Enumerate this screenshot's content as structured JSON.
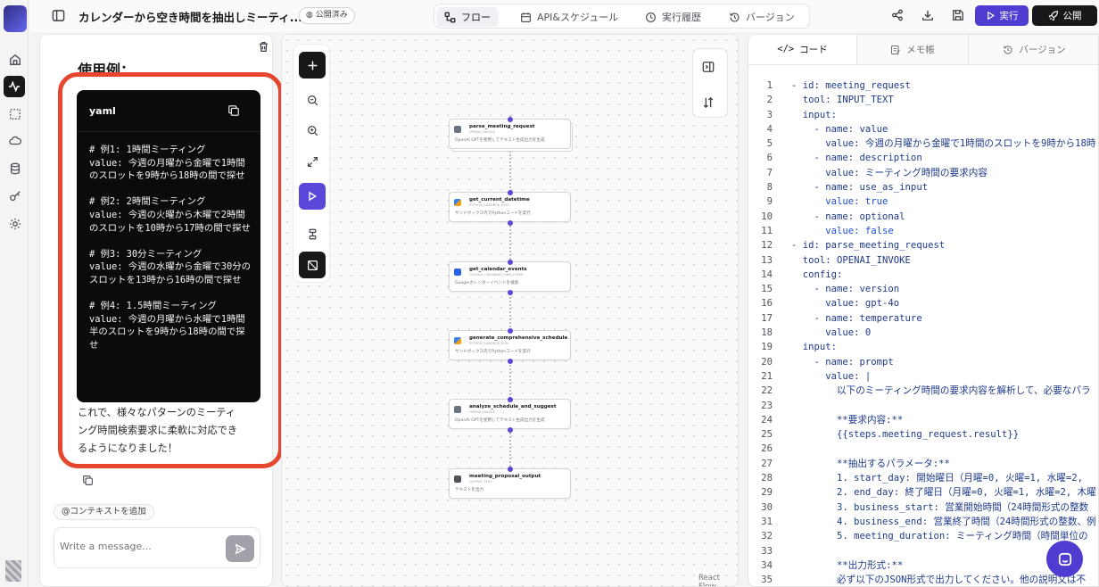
{
  "topbar": {
    "title": "カレンダーから空き時間を抽出しミーティ...",
    "badge": "公開済み",
    "tabs": [
      {
        "label": "フロー",
        "icon": "flow-icon",
        "selected": true
      },
      {
        "label": "API&スケジュール",
        "icon": "calendar-icon"
      },
      {
        "label": "実行履歴",
        "icon": "clock-icon"
      },
      {
        "label": "バージョン",
        "icon": "history-icon"
      }
    ],
    "run_label": "実行",
    "publish_label": "公開"
  },
  "chat": {
    "heading": "使用例：",
    "code_lang": "yaml",
    "code_blocks": [
      "# 例1: 1時間ミーティング\nvalue: 今週の月曜から金曜で1時間のスロットを9時から18時の間で探せ",
      "# 例2: 2時間ミーティング\nvalue: 今週の火曜から木曜で2時間のスロットを10時から17時の間で探せ",
      "# 例3: 30分ミーティング\nvalue: 今週の水曜から金曜で30分のスロットを13時から16時の間で探せ",
      "# 例4: 1.5時間ミーティング\nvalue: 今週の月曜から水曜で1時間半のスロットを9時から18時の間で探せ"
    ],
    "after_text": "これで、様々なパターンのミーティング時間検索要求に柔軟に対応できるようになりました！",
    "context_chip": "@コンテキストを追加",
    "input_placeholder": "Write a message..."
  },
  "flow": {
    "nodes": [
      {
        "name": "parse_meeting_request",
        "tool": "OPENAI_INVOKE",
        "desc": "OpenAI GPTを使用してテキスト生成出力を生成",
        "color": "#6b7280"
      },
      {
        "name": "get_current_datetime",
        "tool": "PYTHON_SANDBOX_RUN",
        "desc": "サンドボックス内でPythonコードを実行",
        "color": "#f59e0b"
      },
      {
        "name": "get_calendar_events",
        "tool": "GOOGLE_CALENDAR_FIND_EVENT",
        "desc": "Googleカレンダーイベントを検索",
        "color": "#2563eb"
      },
      {
        "name": "generate_comprehensive_schedule",
        "tool": "PYTHON_SANDBOX_RUN",
        "desc": "サンドボックス内でPythonコードを実行",
        "color": "#f59e0b"
      },
      {
        "name": "analyze_schedule_and_suggest",
        "tool": "OPENAI_INVOKE",
        "desc": "OpenAI GPTを使用してテキスト生成出力を生成",
        "color": "#6b7280"
      },
      {
        "name": "meeting_proposal_output",
        "tool": "OUTPUT_TEXT",
        "desc": "テキストを出力",
        "color": "#52525b"
      }
    ],
    "attribution": "React Flow"
  },
  "code_panel": {
    "tabs": [
      {
        "label": "コード",
        "icon": "code-icon",
        "selected": true
      },
      {
        "label": "メモ帳",
        "icon": "notepad-icon"
      },
      {
        "label": "バージョン",
        "icon": "history-icon"
      }
    ],
    "lines": [
      "- id: meeting_request",
      "  tool: INPUT_TEXT",
      "  input:",
      "    - name: value",
      "      value: 今週の月曜から金曜で1時間のスロットを9時から18時",
      "    - name: description",
      "      value: ミーティング時間の要求内容",
      "    - name: use_as_input",
      "      value: true",
      "    - name: optional",
      "      value: false",
      "- id: parse_meeting_request",
      "  tool: OPENAI_INVOKE",
      "  config:",
      "    - name: version",
      "      value: gpt-4o",
      "    - name: temperature",
      "      value: 0",
      "  input:",
      "    - name: prompt",
      "      value: |",
      "        以下のミーティング時間の要求内容を解析して、必要なパラ",
      "",
      "        **要求内容:**",
      "        {{steps.meeting_request.result}}",
      "",
      "        **抽出するパラメータ:**",
      "        1. start_day: 開始曜日（月曜=0, 火曜=1, 水曜=2,",
      "        2. end_day: 終了曜日（月曜=0, 火曜=1, 水曜=2, 木曜",
      "        3. business_start: 営業開始時間（24時間形式の整数",
      "        4. business_end: 営業終了時間（24時間形式の整数、例",
      "        5. meeting_duration: ミーティング時間（時間単位の",
      "",
      "        **出力形式:**",
      "        必ず以下のJSON形式で出力してください。他の説明文は不"
    ]
  }
}
